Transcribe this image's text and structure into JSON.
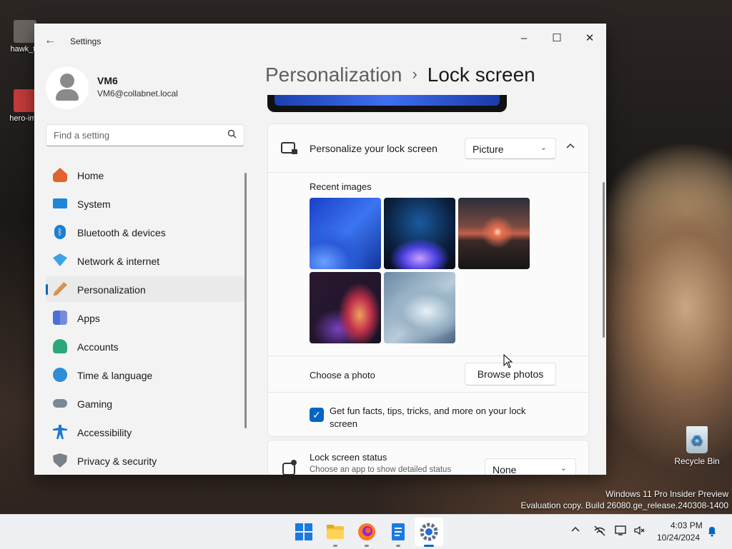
{
  "desktop": {
    "icons": [
      {
        "label": "hawk_tu"
      },
      {
        "label": "hero-ima"
      }
    ],
    "recycle_bin": "Recycle Bin",
    "watermark": {
      "line1": "Windows 11 Pro Insider Preview",
      "line2": "Evaluation copy. Build 26080.ge_release.240308-1400"
    }
  },
  "window": {
    "title": "Settings",
    "controls": {
      "minimize": "–",
      "maximize": "☐",
      "close": "✕"
    }
  },
  "profile": {
    "name": "VM6",
    "email": "VM6@collabnet.local"
  },
  "search": {
    "placeholder": "Find a setting"
  },
  "sidebar": {
    "items": [
      {
        "label": "Home",
        "icon": "home-icon",
        "color": "#e0632e"
      },
      {
        "label": "System",
        "icon": "system-icon",
        "color": "#1d86d6"
      },
      {
        "label": "Bluetooth & devices",
        "icon": "bluetooth-icon",
        "color": "#1b7fd1"
      },
      {
        "label": "Network & internet",
        "icon": "wifi-icon",
        "color": "#3aa3e8"
      },
      {
        "label": "Personalization",
        "icon": "brush-icon",
        "color": "#c07a3a"
      },
      {
        "label": "Apps",
        "icon": "apps-icon",
        "color": "#4a6fd8"
      },
      {
        "label": "Accounts",
        "icon": "accounts-icon",
        "color": "#2aa87a"
      },
      {
        "label": "Time & language",
        "icon": "globe-clock-icon",
        "color": "#2e8dd8"
      },
      {
        "label": "Gaming",
        "icon": "gamepad-icon",
        "color": "#7a8894"
      },
      {
        "label": "Accessibility",
        "icon": "accessibility-icon",
        "color": "#1c78d0"
      },
      {
        "label": "Privacy & security",
        "icon": "shield-icon",
        "color": "#7a8289"
      }
    ],
    "active_index": 4
  },
  "main": {
    "breadcrumb": {
      "parent": "Personalization",
      "separator": "›",
      "current": "Lock screen"
    },
    "personalize": {
      "label": "Personalize your lock screen",
      "dropdown_value": "Picture"
    },
    "recent_images": {
      "label": "Recent images",
      "images": [
        "blue-bloom-wallpaper",
        "dark-glow-wallpaper",
        "sunset-lake-wallpaper",
        "colorful-swirl-wallpaper",
        "pale-blue-bloom-wallpaper"
      ]
    },
    "choose_photo": {
      "label": "Choose a photo",
      "button": "Browse photos"
    },
    "fun_facts": {
      "checked": true,
      "line1": "Get fun facts, tips, tricks, and more on your lock",
      "line2": "screen"
    },
    "lock_status": {
      "label": "Lock screen status",
      "sublabel": "Choose an app to show detailed status",
      "dropdown_value": "None"
    }
  },
  "taskbar": {
    "apps": [
      "start-icon",
      "file-explorer-icon",
      "firefox-icon",
      "notepad-icon",
      "settings-icon"
    ],
    "tray_icons": [
      "chevron-up-icon",
      "network-off-icon",
      "display-icon",
      "volume-muted-icon"
    ],
    "time": "4:03 PM",
    "date": "10/24/2024"
  },
  "colors": {
    "accent": "#0067c0",
    "window_bg": "#f3f3f3",
    "card_bg": "#fbfbfb"
  }
}
